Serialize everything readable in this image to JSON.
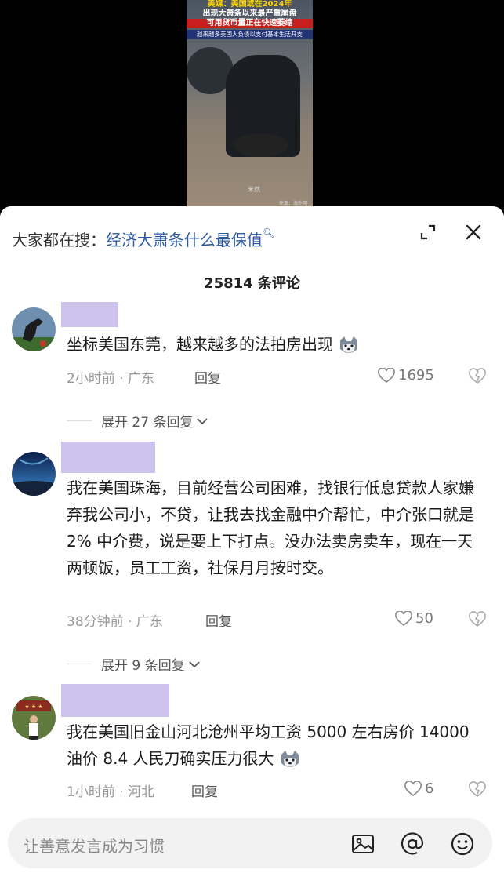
{
  "video": {
    "caption_line1": "美媒：美国或在2024年",
    "caption_line2": "出现大萧条以来最严重崩盘",
    "caption_line3": "可用货币量正在快速萎缩",
    "caption_line4": "越来越多美国人负债以支付基本生活开支",
    "watermark": "米然",
    "source": "来源：海外网"
  },
  "search": {
    "prefix": "大家都在搜：",
    "keyword": "经济大萧条什么最保值"
  },
  "comment_count": "25814 条评论",
  "comments": [
    {
      "text": "坐标美国东莞，越来越多的法拍房出现",
      "time_location": "2小时前 · 广东",
      "reply_label": "回复",
      "likes": "1695",
      "expand": "展开 27 条回复"
    },
    {
      "text": "我在美国珠海，目前经营公司困难，找银行低息贷款人家嫌弃我公司小，不贷，让我去找金融中介帮忙，中介张口就是 2% 中介费，说是要上下打点。没办法卖房卖车，现在一天两顿饭，员工工资，社保月月按时交。",
      "time_location": "38分钟前 · 广东",
      "reply_label": "回复",
      "likes": "50",
      "expand": "展开 9 条回复"
    },
    {
      "text": "我在美国旧金山河北沧州平均工资 5000 左右房价 14000 油价 8.4 人民刀确实压力很大",
      "time_location": "1小时前 · 河北",
      "reply_label": "回复",
      "likes": "6"
    }
  ],
  "input": {
    "placeholder": "让善意发言成为习惯"
  },
  "colors": {
    "name_placeholder": "#cdc3ec",
    "keyword": "#2a58a3"
  },
  "icons": [
    "expand-icon",
    "close-icon",
    "search-icon",
    "heart-icon",
    "dislike-icon",
    "chevron-down-icon",
    "image-icon",
    "at-icon",
    "emoji-icon"
  ]
}
